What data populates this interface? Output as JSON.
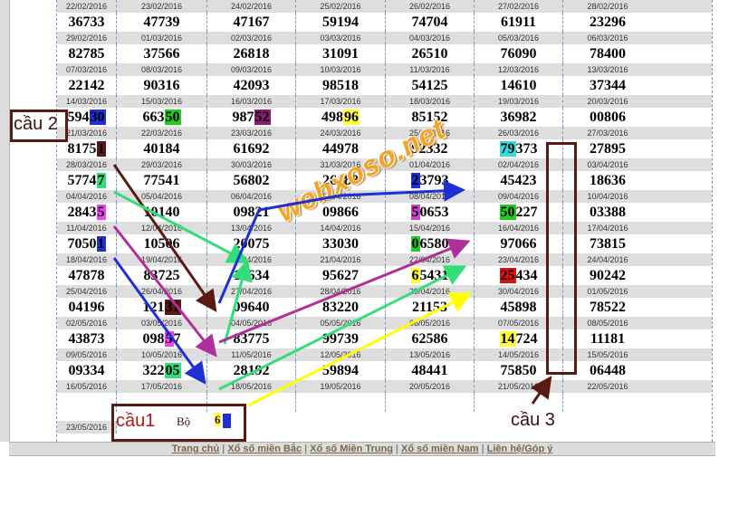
{
  "rows": [
    {
      "dates": [
        "22/02/2016",
        "23/02/2016",
        "24/02/2016",
        "25/02/2016",
        "26/02/2016",
        "27/02/2016",
        "28/02/2016"
      ],
      "nums": [
        {
          "p": "36733"
        },
        {
          "p": "47739"
        },
        {
          "p": "47167"
        },
        {
          "p": "59194"
        },
        {
          "p": "74704"
        },
        {
          "p": "61911"
        },
        {
          "p": "23296"
        }
      ]
    },
    {
      "dates": [
        "29/02/2016",
        "01/03/2016",
        "02/03/2016",
        "03/03/2016",
        "04/03/2016",
        "05/03/2016",
        "06/03/2016"
      ],
      "nums": [
        {
          "p": "82785"
        },
        {
          "p": "37566"
        },
        {
          "p": "26818"
        },
        {
          "p": "31091"
        },
        {
          "p": "26510"
        },
        {
          "p": "76090"
        },
        {
          "p": "78400"
        }
      ]
    },
    {
      "dates": [
        "07/03/2016",
        "08/03/2016",
        "09/03/2016",
        "10/03/2016",
        "11/03/2016",
        "12/03/2016",
        "13/03/2016"
      ],
      "nums": [
        {
          "p": "22142"
        },
        {
          "p": "90316"
        },
        {
          "p": "42093"
        },
        {
          "p": "98518"
        },
        {
          "p": "54125"
        },
        {
          "p": "14610"
        },
        {
          "p": "37344"
        }
      ]
    },
    {
      "dates": [
        "14/03/2016",
        "15/03/2016",
        "16/03/2016",
        "17/03/2016",
        "18/03/2016",
        "19/03/2016",
        "20/03/2016"
      ],
      "nums": [
        {
          "p": "594",
          "h": "30",
          "c": "#1e2fd6",
          "fg": "#000"
        },
        {
          "p": "663",
          "h": "50",
          "c": "#22cc22",
          "fg": "#000"
        },
        {
          "p": "987",
          "h": "52",
          "c": "#8a1a6e",
          "fg": "#000"
        },
        {
          "p": "498",
          "h": "96",
          "c": "#ffff33",
          "fg": "#000"
        },
        {
          "p": "85152"
        },
        {
          "p": "36982"
        },
        {
          "p": "00806"
        }
      ]
    },
    {
      "dates": [
        "21/03/2016",
        "22/03/2016",
        "23/03/2016",
        "24/03/2016",
        "25/03/2016",
        "26/03/2016",
        "27/03/2016"
      ],
      "nums": [
        {
          "p": "8175",
          "h": "1",
          "c": "#5a1a14",
          "fg": "#000"
        },
        {
          "p": "40184"
        },
        {
          "p": "61692"
        },
        {
          "p": "44978"
        },
        {
          "p": "92332"
        },
        {
          "h": "79",
          "c": "#33dddd",
          "fg": "#000",
          "s": "373"
        },
        {
          "p": "27895"
        }
      ]
    },
    {
      "dates": [
        "28/03/2016",
        "29/03/2016",
        "30/03/2016",
        "31/03/2016",
        "01/04/2016",
        "02/04/2016",
        "03/04/2016"
      ],
      "nums": [
        {
          "p": "5774",
          "h": "7",
          "c": "#33dd77",
          "fg": "#000"
        },
        {
          "p": "77541"
        },
        {
          "p": "56802"
        },
        {
          "p": "26188"
        },
        {
          "h": "2",
          "c": "#1e2fd6",
          "fg": "#000",
          "s": "3793"
        },
        {
          "p": "45423"
        },
        {
          "p": "18636"
        }
      ]
    },
    {
      "dates": [
        "04/04/2016",
        "05/04/2016",
        "06/04/2016",
        "07/04/2016",
        "08/04/2016",
        "09/04/2016",
        "10/04/2016"
      ],
      "nums": [
        {
          "p": "2843",
          "h": "5",
          "c": "#ee44ee",
          "fg": "#000"
        },
        {
          "p": "10140"
        },
        {
          "p": "09821"
        },
        {
          "p": "09866"
        },
        {
          "h": "5",
          "c": "#cc44cc",
          "fg": "#000",
          "s": "0653"
        },
        {
          "h": "50",
          "c": "#22cc22",
          "fg": "#000",
          "s": "227"
        },
        {
          "p": "03388"
        }
      ]
    },
    {
      "dates": [
        "11/04/2016",
        "12/04/2016",
        "13/04/2016",
        "14/04/2016",
        "15/04/2016",
        "16/04/2016",
        "17/04/2016"
      ],
      "nums": [
        {
          "p": "7050",
          "h": "1",
          "c": "#1e2fd6",
          "fg": "#000"
        },
        {
          "p": "10506"
        },
        {
          "p": "20075"
        },
        {
          "p": "33030"
        },
        {
          "h": "0",
          "c": "#22cc22",
          "fg": "#000",
          "s": "6580"
        },
        {
          "p": "97066"
        },
        {
          "p": "73815"
        }
      ]
    },
    {
      "dates": [
        "18/04/2016",
        "19/04/2016",
        "20/04/2016",
        "21/04/2016",
        "22/04/2016",
        "23/04/2016",
        "24/04/2016"
      ],
      "nums": [
        {
          "p": "47878"
        },
        {
          "p": "83725"
        },
        {
          "p": "16634"
        },
        {
          "p": "95627"
        },
        {
          "h": "6",
          "c": "#ffff33",
          "fg": "#000",
          "s": "5431"
        },
        {
          "h": "25",
          "c": "#dd1111",
          "fg": "#000",
          "s": "434"
        },
        {
          "p": "90242"
        }
      ]
    },
    {
      "dates": [
        "25/04/2016",
        "26/04/2016",
        "27/04/2016",
        "28/04/2016",
        "29/04/2016",
        "30/04/2016",
        "01/05/2016"
      ],
      "nums": [
        {
          "p": "04196"
        },
        {
          "p": "121",
          "h": "31",
          "c": "#5a1a14",
          "fg": "#000"
        },
        {
          "p": "09640"
        },
        {
          "p": "83220"
        },
        {
          "p": "21153"
        },
        {
          "p": "45898"
        },
        {
          "p": "78522"
        }
      ]
    },
    {
      "dates": [
        "02/05/2016",
        "03/05/2016",
        "04/05/2016",
        "05/05/2016",
        "06/05/2016",
        "07/05/2016",
        "08/05/2016"
      ],
      "nums": [
        {
          "p": "43873"
        },
        {
          "p": "098",
          "h": "5",
          "c": "#ee44ee",
          "fg": "#000",
          "s": "7"
        },
        {
          "p": "83775"
        },
        {
          "p": "99739"
        },
        {
          "p": "62586"
        },
        {
          "h": "14",
          "c": "#ffff33",
          "fg": "#000",
          "s": "724"
        },
        {
          "p": "11181"
        }
      ]
    },
    {
      "dates": [
        "09/05/2016",
        "10/05/2016",
        "11/05/2016",
        "12/05/2016",
        "13/05/2016",
        "14/05/2016",
        "15/05/2016"
      ],
      "nums": [
        {
          "p": "09334"
        },
        {
          "p": "322",
          "h": "05",
          "c": "#33dd77",
          "fg": "#000"
        },
        {
          "p": "28192"
        },
        {
          "p": "59894"
        },
        {
          "p": "48441"
        },
        {
          "p": "75850"
        },
        {
          "p": "06448"
        }
      ]
    },
    {
      "dates": [
        "16/05/2016",
        "17/05/2016",
        "18/05/2016",
        "19/05/2016",
        "20/05/2016",
        "21/05/2016",
        "22/05/2016"
      ],
      "nums": []
    }
  ],
  "last_date": "23/05/2016",
  "bo_text": "Bộ",
  "bo_digit": "6",
  "footer": {
    "links": [
      "Trang chủ",
      "Xổ số miền Bắc",
      "Xổ số Miền Trung",
      "Xổ số miền Nam",
      "Liên hệ/Góp ý"
    ],
    "sep": "|"
  },
  "annotations": {
    "cau1": "cầu1",
    "cau2": "cầu 2",
    "cau3": "cầu 3"
  },
  "watermark": "webxoso.net",
  "colors": {
    "blue": "#1e2fd6",
    "green": "#22cc22",
    "purple": "#8a1a6e",
    "yellow": "#ffff33",
    "cyan": "#33dddd",
    "red": "#dd1111",
    "brown": "#5a1a14",
    "magenta": "#ee44ee",
    "mint": "#33dd77"
  }
}
